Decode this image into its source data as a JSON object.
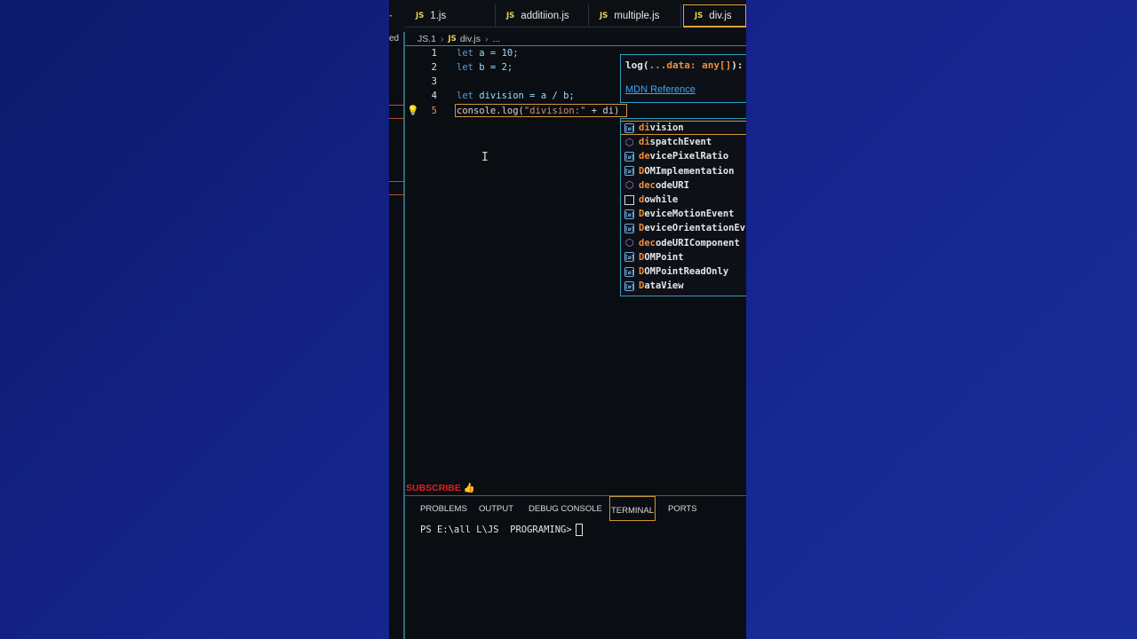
{
  "tabs": [
    {
      "label": "1.js",
      "icon": "JS"
    },
    {
      "label": "additiion.js",
      "icon": "JS"
    },
    {
      "label": "multiple.js",
      "icon": "JS"
    },
    {
      "label": "div.js",
      "icon": "JS",
      "active": true
    }
  ],
  "tab_stub": "·",
  "sidebar_fragment": "ed",
  "breadcrumb": {
    "folder": "JS.1",
    "file_icon": "JS",
    "file": "div.js",
    "more": "..."
  },
  "code_lines": [
    {
      "num": "1",
      "kw": "let",
      "rest": " a = 10;"
    },
    {
      "num": "2",
      "kw": "let",
      "rest": " b = 2;"
    },
    {
      "num": "3",
      "kw": "",
      "rest": ""
    },
    {
      "num": "4",
      "kw": "let",
      "rest": " division = a / b;"
    },
    {
      "num": "5",
      "pre": "console.log(",
      "str": "\"division:\"",
      "post": " + di)"
    }
  ],
  "hover": {
    "sig_pre": "log(",
    "sig_hl": "...data: any[]",
    "sig_post": "):",
    "link": "MDN Reference"
  },
  "suggestions": [
    {
      "match": "di",
      "rest": "vision",
      "kind": "variable"
    },
    {
      "match": "di",
      "rest": "spatchEvent",
      "kind": "method"
    },
    {
      "match": "de",
      "rest": "vicePixelRatio",
      "kind": "variable"
    },
    {
      "match": "D",
      "rest": "OMImplementation",
      "kind": "variable"
    },
    {
      "match": "dec",
      "rest": "odeURI",
      "kind": "method"
    },
    {
      "match": "d",
      "rest": "owhile",
      "kind": "snippet"
    },
    {
      "match": "D",
      "rest": "eviceMotionEvent",
      "kind": "variable"
    },
    {
      "match": "D",
      "rest": "eviceOrientationEv",
      "kind": "variable"
    },
    {
      "match": "dec",
      "rest": "odeURIComponent",
      "kind": "method"
    },
    {
      "match": "D",
      "rest": "OMPoint",
      "kind": "variable"
    },
    {
      "match": "D",
      "rest": "OMPointReadOnly",
      "kind": "variable"
    },
    {
      "match": "D",
      "rest": "ataView",
      "kind": "variable"
    }
  ],
  "subscribe": "SUBSCRIBE",
  "panel_tabs": [
    "PROBLEMS",
    "OUTPUT",
    "DEBUG CONSOLE",
    "TERMINAL",
    "PORTS"
  ],
  "active_panel": "TERMINAL",
  "terminal_prompt": "PS E:\\all L\\JS  PROGRAMING>",
  "colors": {
    "accent": "#d19535",
    "border": "#2f9fbf",
    "background": "#0a0d12"
  }
}
